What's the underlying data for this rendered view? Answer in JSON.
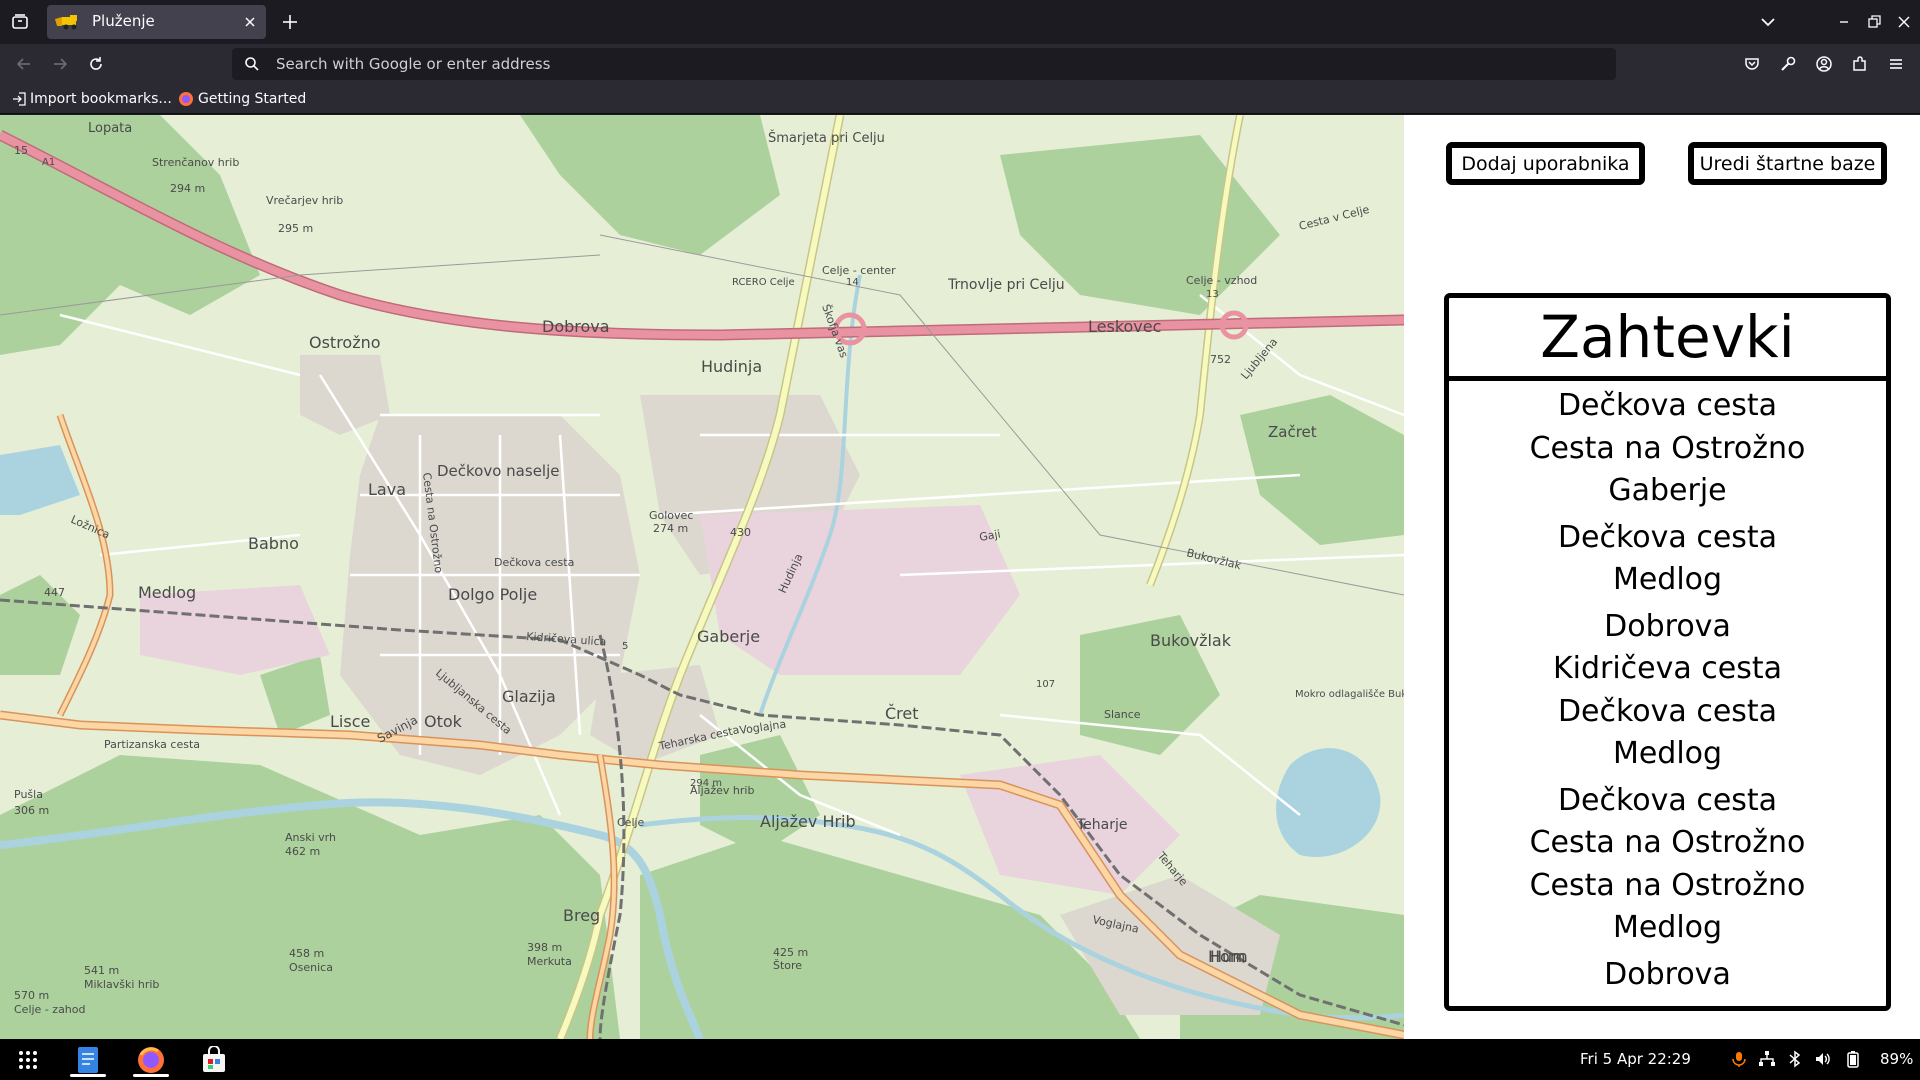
{
  "browser": {
    "tab": {
      "title": "Pluženje"
    },
    "urlbar": {
      "placeholder": "Search with Google or enter address"
    },
    "bookmarks": [
      {
        "label": "Import bookmarks..."
      },
      {
        "label": "Getting Started"
      }
    ]
  },
  "map": {
    "place_labels": [
      "Lopata",
      "Strenčanov hrib",
      "294 m",
      "Vrečarjev hrib",
      "295 m",
      "Šmarjeta pri Celju",
      "Škofja vas",
      "Celje - center",
      "14",
      "Trnovlje pri Celju",
      "Celje - vzhod",
      "13",
      "Cesta v Celje",
      "Dobrova",
      "Ostrožno",
      "Hudinja",
      "Leskovec",
      "752",
      "Ljubljena",
      "Začret",
      "Cesta na Ostrožno",
      "Lava",
      "Dečkovo naselje",
      "Golovec",
      "274 m",
      "430",
      "Gaji",
      "Babno",
      "Ložnica",
      "Dečkova cesta",
      "Bukovžlak",
      "447",
      "Medlog",
      "Dolgo Polje",
      "Kidričeva ulica",
      "5",
      "Gaberje",
      "Hudinja",
      "Bukovžlak",
      "Glazija",
      "107",
      "Ljubljanska cesta",
      "Otok",
      "Lisce",
      "Savinja",
      "Čret",
      "Slance",
      "Mokro odlagališče Bukovžlak",
      "Partizanska cesta",
      "Teharska cesta",
      "Voglajna",
      "Celje",
      "Aljažev hrib",
      "Aljažev Hrib",
      "294 m",
      "Pušla",
      "306 m",
      "Anski vrh",
      "462 m",
      "Teharje",
      "Teharje",
      "Breg",
      "Voglajna",
      "Hum",
      "541 m",
      "Miklavški hrib",
      "398 m",
      "Merkuta",
      "458 m",
      "Osenica",
      "425 m",
      "Štore",
      "Hom",
      "570 m",
      "Celje - zahod",
      "15",
      "A1",
      "RCERO Celje"
    ]
  },
  "panel": {
    "add_user_button": "Dodaj uporabnika",
    "edit_bases_button": "Uredi štartne baze",
    "requests_title": "Zahtevki",
    "requests": [
      {
        "lines": [
          "Dečkova cesta",
          "Cesta na Ostrožno",
          "Gaberje"
        ]
      },
      {
        "lines": [
          "Dečkova cesta",
          "Medlog"
        ]
      },
      {
        "lines": [
          "Dobrova",
          "Kidričeva cesta",
          "Dečkova cesta",
          "Medlog"
        ]
      },
      {
        "lines": [
          "Dečkova cesta",
          "Cesta na Ostrožno",
          "Cesta na Ostrožno",
          "Medlog"
        ]
      },
      {
        "lines": [
          "Dobrova"
        ]
      }
    ]
  },
  "taskbar": {
    "clock": "Fri 5 Apr  22:29",
    "battery": "89%",
    "apps": [
      "app-grid-icon",
      "text-editor-icon",
      "firefox-icon",
      "software-store-icon"
    ]
  },
  "colors": {
    "chrome_dark": "#1c1b22",
    "chrome_toolbar": "#2b2a33",
    "motorway": "#e892a2",
    "primary_road": "#f9b26b",
    "secondary_road": "#f7fabf",
    "water": "#aad3df",
    "forest": "#add19e"
  }
}
